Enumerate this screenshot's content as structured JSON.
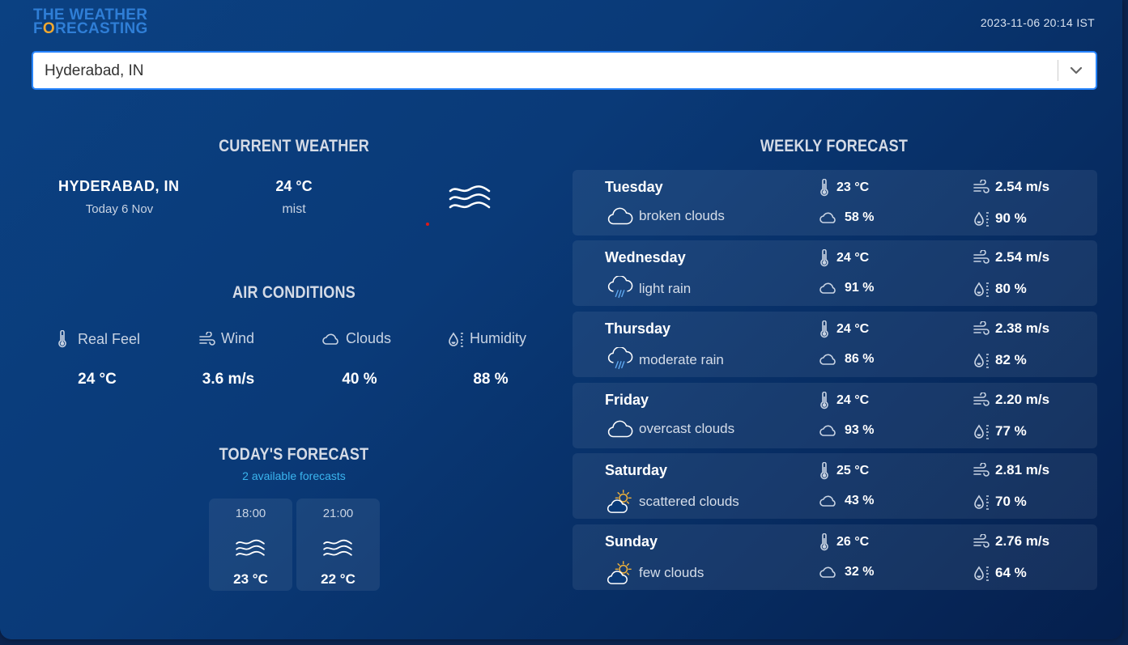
{
  "header": {
    "logo_line1": "THE WEATHER",
    "logo_line2_first": "F",
    "logo_line2_o": "O",
    "logo_line2_rest": "RECASTING",
    "datetime": "2023-11-06 20:14 IST"
  },
  "search": {
    "value": "Hyderabad, IN",
    "icon": "chevron-down-icon"
  },
  "current_weather": {
    "title": "CURRENT WEATHER",
    "city": "HYDERABAD, IN",
    "date": "Today 6 Nov",
    "temperature": "24 °C",
    "description": "mist",
    "icon": "mist-icon"
  },
  "air_conditions": {
    "title": "AIR CONDITIONS",
    "items": [
      {
        "label": "Real Feel",
        "value": "24 °C",
        "icon": "thermometer-icon"
      },
      {
        "label": "Wind",
        "value": "3.6 m/s",
        "icon": "wind-icon"
      },
      {
        "label": "Clouds",
        "value": "40 %",
        "icon": "cloud-icon"
      },
      {
        "label": "Humidity",
        "value": "88 %",
        "icon": "humidity-icon"
      }
    ]
  },
  "todays_forecast": {
    "title": "TODAY'S FORECAST",
    "subtitle": "2 available forecasts",
    "items": [
      {
        "time": "18:00",
        "temperature": "23 °C",
        "icon": "mist-icon"
      },
      {
        "time": "21:00",
        "temperature": "22 °C",
        "icon": "mist-icon"
      }
    ]
  },
  "weekly_forecast": {
    "title": "WEEKLY FORECAST",
    "days": [
      {
        "day": "Tuesday",
        "condition": "broken clouds",
        "icon": "cloud-icon",
        "temperature": "23 °C",
        "clouds": "58 %",
        "wind": "2.54 m/s",
        "humidity": "90 %"
      },
      {
        "day": "Wednesday",
        "condition": "light rain",
        "icon": "rain-icon",
        "temperature": "24 °C",
        "clouds": "91 %",
        "wind": "2.54 m/s",
        "humidity": "80 %"
      },
      {
        "day": "Thursday",
        "condition": "moderate rain",
        "icon": "rain-icon",
        "temperature": "24 °C",
        "clouds": "86 %",
        "wind": "2.38 m/s",
        "humidity": "82 %"
      },
      {
        "day": "Friday",
        "condition": "overcast clouds",
        "icon": "cloud-icon",
        "temperature": "24 °C",
        "clouds": "93 %",
        "wind": "2.20 m/s",
        "humidity": "77 %"
      },
      {
        "day": "Saturday",
        "condition": "scattered clouds",
        "icon": "sun-cloud-icon",
        "temperature": "25 °C",
        "clouds": "43 %",
        "wind": "2.81 m/s",
        "humidity": "70 %"
      },
      {
        "day": "Sunday",
        "condition": "few clouds",
        "icon": "sun-cloud-icon",
        "temperature": "26 °C",
        "clouds": "32 %",
        "wind": "2.76 m/s",
        "humidity": "64 %"
      }
    ]
  },
  "colors": {
    "accent": "#2684ff",
    "logo_blue": "#2f7ed6",
    "logo_orange": "#f0a830",
    "subtitle_cyan": "#3bb5ef"
  }
}
